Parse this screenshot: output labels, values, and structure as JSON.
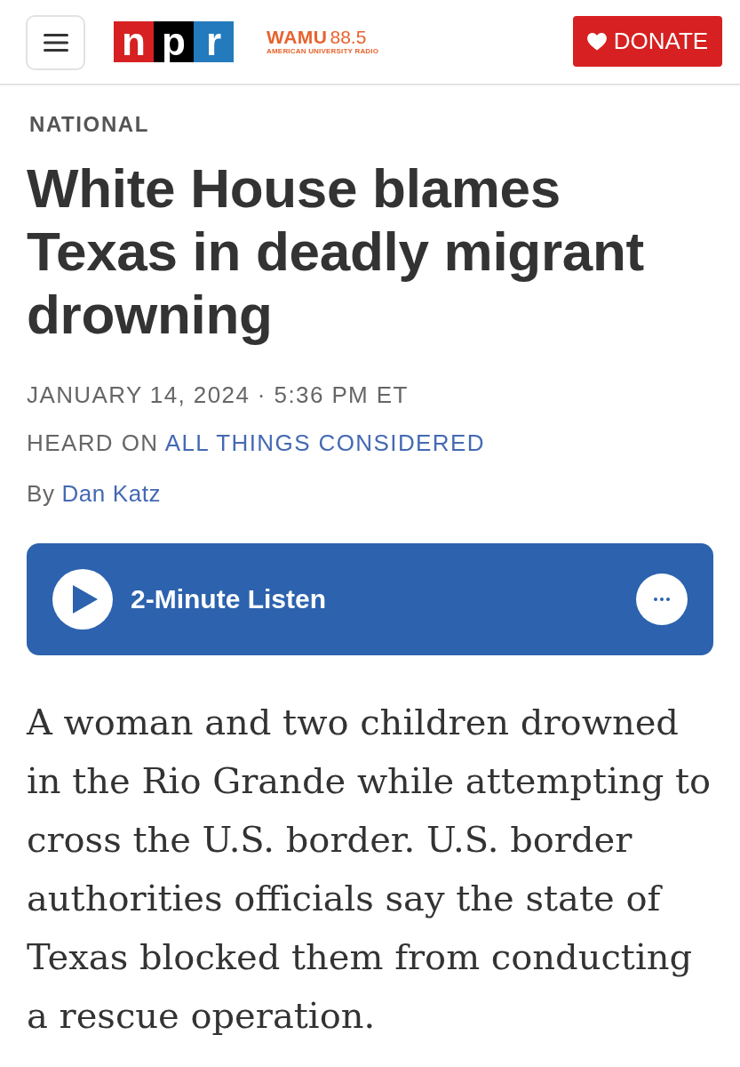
{
  "header": {
    "logo": {
      "letters": [
        {
          "char": "n",
          "color": "#d62021"
        },
        {
          "char": "p",
          "color": "#000000"
        },
        {
          "char": "r",
          "color": "#237bbd"
        }
      ]
    },
    "station": {
      "name": "WAMU",
      "frequency": "88.5",
      "tagline": "AMERICAN UNIVERSITY RADIO"
    },
    "donate_button": {
      "label": "DONATE"
    }
  },
  "article": {
    "section": "NATIONAL",
    "headline": "White House blames Texas in deadly migrant drowning",
    "dateline": "JANUARY 14, 2024 · 5:36 PM ET",
    "heard_on": {
      "label": "HEARD ON",
      "program": "ALL THINGS CONSIDERED"
    },
    "byline": {
      "prefix": "By",
      "author": "Dan Katz"
    },
    "audio": {
      "title": "2-Minute Listen"
    },
    "body": "A woman and two children drowned in the Rio Grande while attempting to cross the U.S. border. U.S. border authorities officials say the state of Texas blocked them from conducting a rescue operation."
  }
}
